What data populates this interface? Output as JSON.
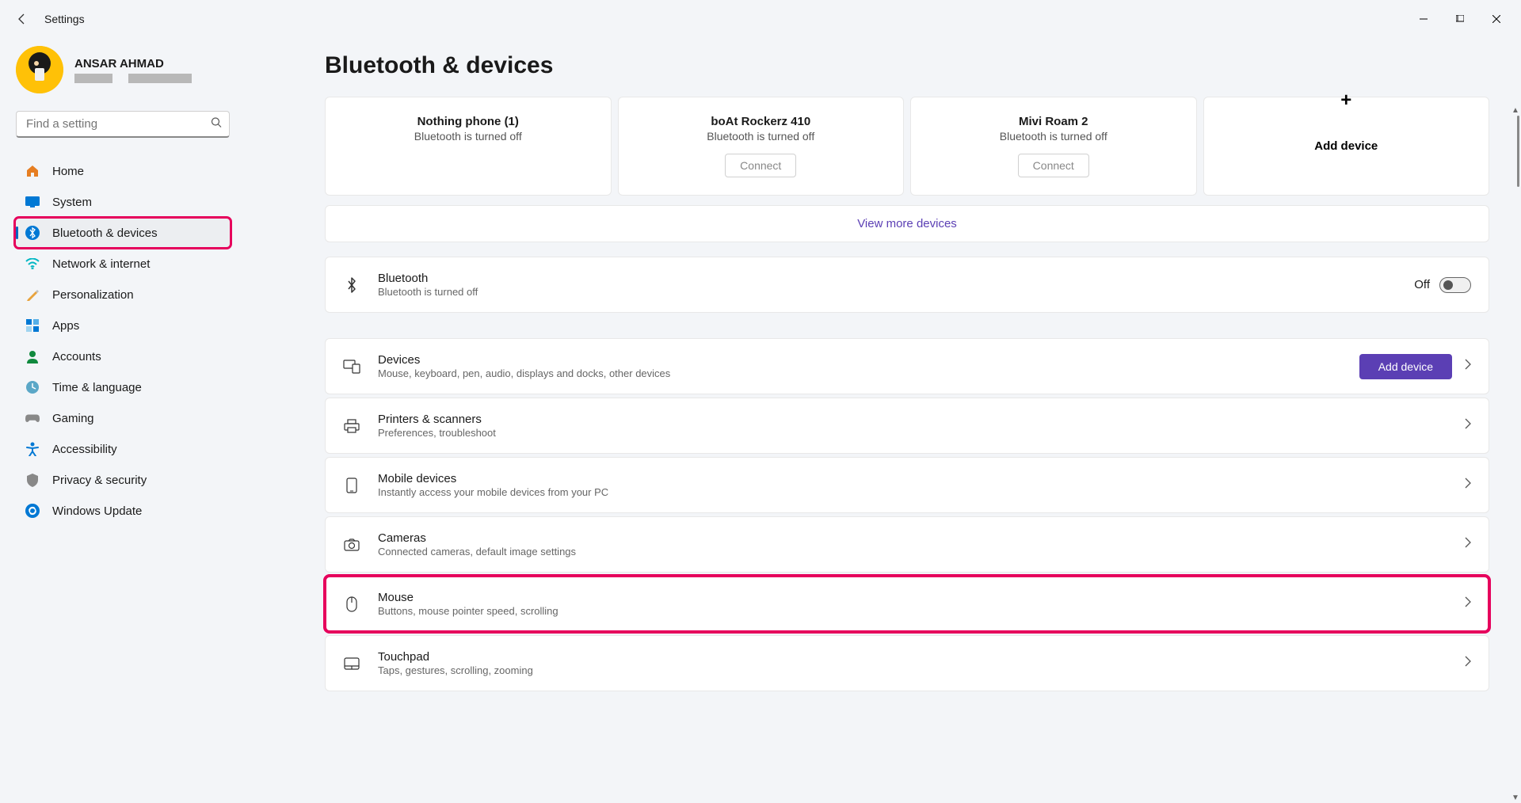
{
  "window": {
    "title": "Settings"
  },
  "account": {
    "name": "ANSAR AHMAD"
  },
  "search": {
    "placeholder": "Find a setting"
  },
  "nav": [
    {
      "icon": "home",
      "label": "Home",
      "color": "#e67e22"
    },
    {
      "icon": "system",
      "label": "System",
      "color": "#0078d4"
    },
    {
      "icon": "bluetooth",
      "label": "Bluetooth & devices",
      "color": "#0078d4",
      "active": true,
      "highlighted": true
    },
    {
      "icon": "network",
      "label": "Network & internet",
      "color": "#00b7c3"
    },
    {
      "icon": "personalization",
      "label": "Personalization",
      "color": "#e8a33d"
    },
    {
      "icon": "apps",
      "label": "Apps",
      "color": "#0078d4"
    },
    {
      "icon": "accounts",
      "label": "Accounts",
      "color": "#10893e"
    },
    {
      "icon": "time",
      "label": "Time & language",
      "color": "#5ba7c7"
    },
    {
      "icon": "gaming",
      "label": "Gaming",
      "color": "#888"
    },
    {
      "icon": "accessibility",
      "label": "Accessibility",
      "color": "#0078d4"
    },
    {
      "icon": "privacy",
      "label": "Privacy & security",
      "color": "#888"
    },
    {
      "icon": "update",
      "label": "Windows Update",
      "color": "#0078d4"
    }
  ],
  "page": {
    "title": "Bluetooth & devices"
  },
  "devices": [
    {
      "name": "Nothing phone (1)",
      "status": "Bluetooth is turned off",
      "connect": false
    },
    {
      "name": "boAt Rockerz 410",
      "status": "Bluetooth is turned off",
      "connect": true,
      "connect_label": "Connect"
    },
    {
      "name": "Mivi Roam 2",
      "status": "Bluetooth is turned off",
      "connect": true,
      "connect_label": "Connect"
    }
  ],
  "add_device_card_label": "Add device",
  "view_more_label": "View more devices",
  "bluetooth_toggle": {
    "title": "Bluetooth",
    "desc": "Bluetooth is turned off",
    "state_label": "Off"
  },
  "settings": [
    {
      "key": "devices",
      "icon": "devices",
      "title": "Devices",
      "desc": "Mouse, keyboard, pen, audio, displays and docks, other devices",
      "button": "Add device"
    },
    {
      "key": "printers",
      "icon": "printer",
      "title": "Printers & scanners",
      "desc": "Preferences, troubleshoot"
    },
    {
      "key": "mobile",
      "icon": "mobile",
      "title": "Mobile devices",
      "desc": "Instantly access your mobile devices from your PC"
    },
    {
      "key": "cameras",
      "icon": "camera",
      "title": "Cameras",
      "desc": "Connected cameras, default image settings"
    },
    {
      "key": "mouse",
      "icon": "mouse",
      "title": "Mouse",
      "desc": "Buttons, mouse pointer speed, scrolling",
      "highlighted": true
    },
    {
      "key": "touchpad",
      "icon": "touchpad",
      "title": "Touchpad",
      "desc": "Taps, gestures, scrolling, zooming"
    }
  ]
}
